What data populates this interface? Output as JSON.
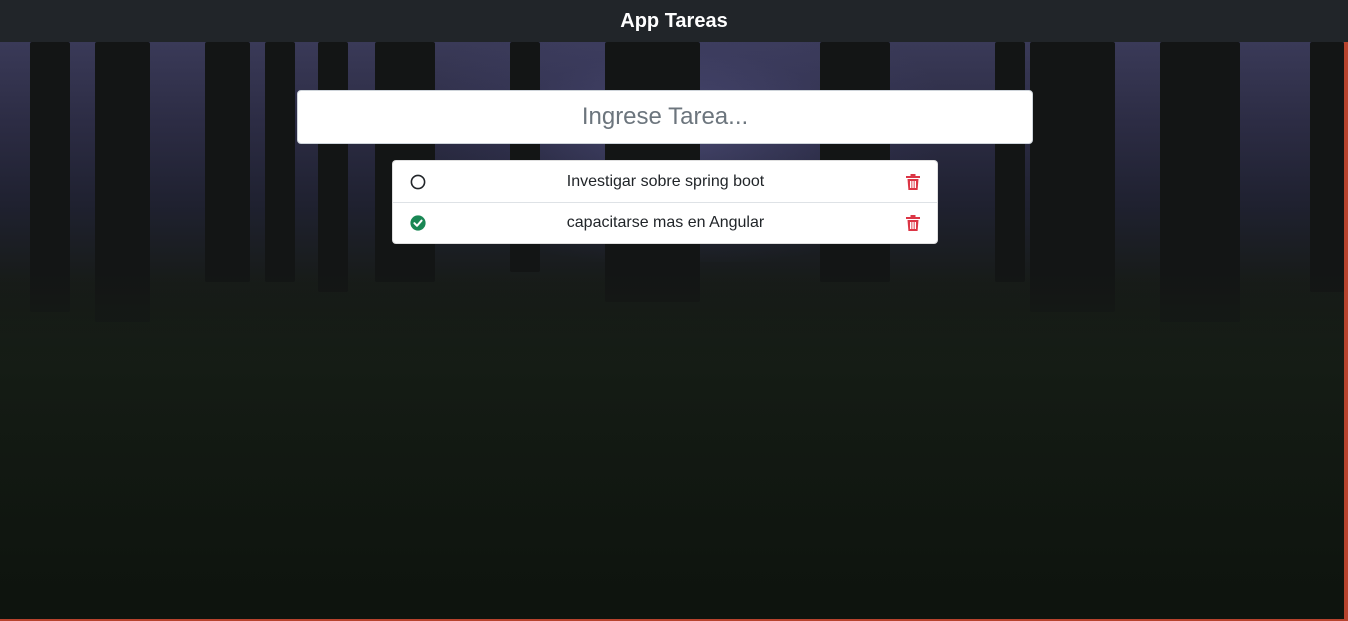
{
  "app": {
    "title": "App Tareas"
  },
  "new_task": {
    "placeholder": "Ingrese Tarea...",
    "value": ""
  },
  "tasks": [
    {
      "text": "Investigar sobre spring boot",
      "completed": false
    },
    {
      "text": "capacitarse mas en Angular",
      "completed": true
    }
  ],
  "colors": {
    "navbar": "#212529",
    "completed_check": "#198754",
    "delete_icon": "#dc3545",
    "window_border": "#b8432e"
  },
  "icons": {
    "pending": "circle-outline-icon",
    "completed": "check-circle-icon",
    "delete": "trash-icon"
  }
}
